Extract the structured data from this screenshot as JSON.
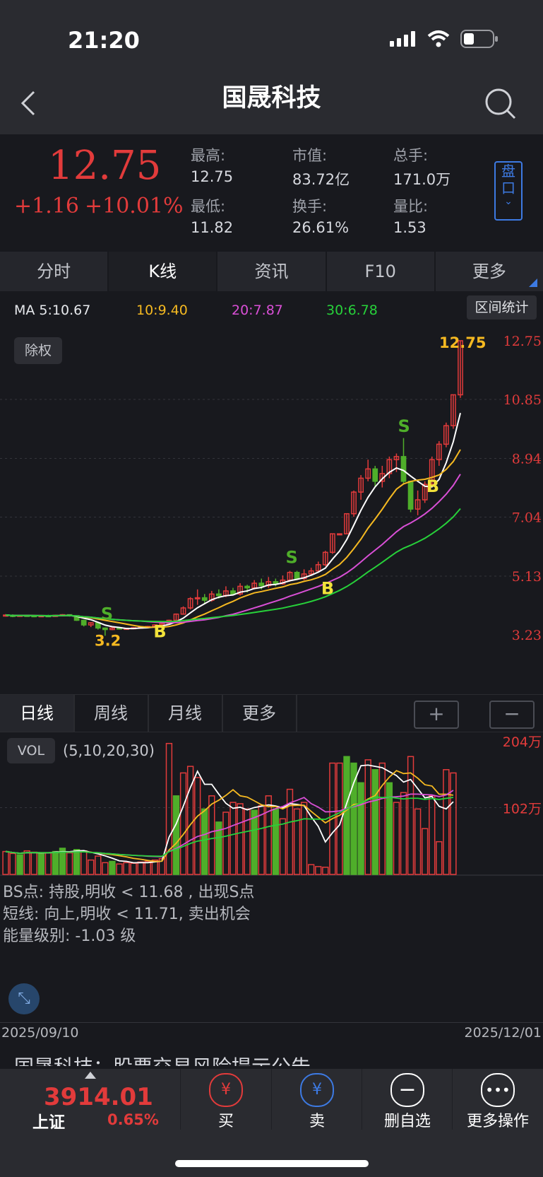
{
  "status_bar": {
    "time": "21:20"
  },
  "nav": {
    "title": "国晟科技"
  },
  "quote": {
    "price": "12.75",
    "change": "+1.16",
    "change_pct": "+10.01%",
    "stats": [
      {
        "label": "最高:",
        "value": "12.75"
      },
      {
        "label": "市值:",
        "value": "83.72亿"
      },
      {
        "label": "总手:",
        "value": "171.0万"
      },
      {
        "label": "最低:",
        "value": "11.82"
      },
      {
        "label": "换手:",
        "value": "26.61%"
      },
      {
        "label": "量比:",
        "value": "1.53"
      }
    ],
    "panel_button": "盘口"
  },
  "tabs": [
    "分时",
    "K线",
    "资讯",
    "F10",
    "更多"
  ],
  "ma": {
    "ma5": "MA 5:10.67",
    "ma10": "10:9.40",
    "ma20": "20:7.87",
    "ma30": "30:6.78"
  },
  "range_button": "区间统计",
  "chuquan": "除权",
  "colors": {
    "up": "#e23b3b",
    "down": "#4fae2a",
    "ma5": "#ffffff",
    "ma10": "#f5b921",
    "ma20": "#d94fd6",
    "ma30": "#27d13a",
    "accent": "#3d7ae3"
  },
  "price_axis": [
    "12.75",
    "10.85",
    "8.94",
    "7.04",
    "5.13",
    "3.23"
  ],
  "markers": {
    "high": "12.75",
    "low": "3.2",
    "s": "S",
    "b": "B"
  },
  "period_tabs": [
    "日线",
    "周线",
    "月线",
    "更多"
  ],
  "zoom": {
    "in": "+",
    "out": "−"
  },
  "volume": {
    "badge": "VOL",
    "params": "(5,10,20,30)",
    "axis": [
      "204万",
      "102万"
    ]
  },
  "notes": [
    "BS点: 持股,明收 < 11.68 , 出现S点",
    " 短线: 向上,明收 < 11.71, 卖出机会",
    " 能量级别: -1.03 级"
  ],
  "dates": {
    "start": "2025/09/10",
    "end": "2025/12/01"
  },
  "news": "国晟科技：股票交易风险提示公告",
  "bottom": {
    "index_value": "3914.01",
    "index_name": "上证",
    "index_pct": "0.65%",
    "buy": "买",
    "sell": "卖",
    "remove": "删自选",
    "more_ops": "更多操作"
  },
  "chart_data": {
    "type": "candlestick",
    "x_range": [
      "2025/09/10",
      "2025/12/01"
    ],
    "price_ylim": [
      3.23,
      12.75
    ],
    "candles": [
      [
        3.85,
        3.87,
        3.82,
        3.9
      ],
      [
        3.86,
        3.84,
        3.8,
        3.89
      ],
      [
        3.84,
        3.86,
        3.82,
        3.88
      ],
      [
        3.86,
        3.85,
        3.83,
        3.88
      ],
      [
        3.85,
        3.83,
        3.8,
        3.87
      ],
      [
        3.83,
        3.85,
        3.81,
        3.87
      ],
      [
        3.85,
        3.84,
        3.82,
        3.88
      ],
      [
        3.84,
        3.86,
        3.83,
        3.88
      ],
      [
        3.86,
        3.88,
        3.85,
        3.9
      ],
      [
        3.88,
        3.85,
        3.82,
        3.89
      ],
      [
        3.85,
        3.7,
        3.68,
        3.86
      ],
      [
        3.7,
        3.55,
        3.5,
        3.71
      ],
      [
        3.55,
        3.62,
        3.48,
        3.64
      ],
      [
        3.62,
        3.45,
        3.4,
        3.63
      ],
      [
        3.45,
        3.4,
        3.2,
        3.47
      ],
      [
        3.4,
        3.45,
        3.38,
        3.48
      ],
      [
        3.45,
        3.42,
        3.4,
        3.47
      ],
      [
        3.42,
        3.44,
        3.4,
        3.46
      ],
      [
        3.44,
        3.46,
        3.42,
        3.48
      ],
      [
        3.46,
        3.48,
        3.44,
        3.5
      ],
      [
        3.48,
        3.5,
        3.46,
        3.52
      ],
      [
        3.5,
        3.55,
        3.48,
        3.57
      ],
      [
        3.55,
        3.6,
        3.53,
        3.62
      ],
      [
        3.6,
        3.7,
        3.58,
        3.72
      ],
      [
        3.7,
        3.9,
        3.68,
        3.92
      ],
      [
        3.9,
        4.1,
        3.88,
        4.15
      ],
      [
        4.1,
        4.4,
        4.05,
        4.45
      ],
      [
        4.4,
        4.43,
        4.2,
        4.7
      ],
      [
        4.43,
        4.35,
        4.25,
        4.55
      ],
      [
        4.35,
        4.55,
        4.3,
        4.65
      ],
      [
        4.55,
        4.5,
        4.4,
        4.7
      ],
      [
        4.5,
        4.65,
        4.45,
        4.8
      ],
      [
        4.65,
        4.55,
        4.5,
        4.75
      ],
      [
        4.55,
        4.8,
        4.5,
        4.9
      ],
      [
        4.8,
        4.75,
        4.6,
        4.85
      ],
      [
        4.75,
        4.9,
        4.7,
        5.0
      ],
      [
        4.9,
        4.82,
        4.7,
        5.05
      ],
      [
        4.82,
        4.95,
        4.75,
        5.1
      ],
      [
        4.95,
        4.88,
        4.8,
        5.05
      ],
      [
        4.88,
        5.0,
        4.85,
        5.15
      ],
      [
        5.0,
        5.25,
        4.95,
        5.3
      ],
      [
        5.25,
        5.05,
        5.0,
        5.3
      ],
      [
        5.05,
        5.2,
        5.0,
        5.35
      ],
      [
        5.2,
        5.3,
        5.15,
        5.4
      ],
      [
        5.3,
        5.5,
        5.25,
        5.6
      ],
      [
        5.5,
        5.9,
        5.45,
        5.95
      ],
      [
        5.9,
        6.5,
        5.85,
        6.5
      ],
      [
        6.5,
        6.5,
        6.5,
        6.5
      ],
      [
        6.5,
        7.15,
        6.5,
        7.15
      ],
      [
        7.15,
        7.85,
        7.05,
        7.9
      ],
      [
        7.85,
        8.3,
        7.6,
        8.4
      ],
      [
        8.3,
        8.6,
        8.2,
        8.9
      ],
      [
        8.6,
        8.2,
        8.0,
        8.7
      ],
      [
        8.2,
        8.45,
        8.0,
        8.7
      ],
      [
        8.45,
        8.9,
        8.3,
        9.0
      ],
      [
        8.9,
        9.0,
        8.5,
        9.1
      ],
      [
        9.0,
        8.2,
        8.1,
        9.6
      ],
      [
        8.2,
        7.3,
        7.2,
        7.5
      ],
      [
        7.3,
        7.6,
        7.1,
        7.9
      ],
      [
        7.6,
        8.1,
        7.5,
        8.2
      ],
      [
        8.1,
        8.9,
        8.0,
        9.0
      ],
      [
        8.9,
        9.4,
        8.7,
        9.5
      ],
      [
        9.4,
        10.0,
        9.3,
        10.1
      ],
      [
        10.0,
        11.0,
        9.9,
        11.0
      ],
      [
        11.0,
        12.75,
        10.9,
        12.75
      ]
    ],
    "volume_ylim": [
      0,
      204
    ],
    "volume_unit": "万",
    "volume": [
      [
        35,
        1
      ],
      [
        32,
        1
      ],
      [
        30,
        0
      ],
      [
        36,
        1
      ],
      [
        34,
        1
      ],
      [
        32,
        0
      ],
      [
        33,
        1
      ],
      [
        35,
        0
      ],
      [
        40,
        0
      ],
      [
        33,
        1
      ],
      [
        38,
        0
      ],
      [
        36,
        1
      ],
      [
        22,
        1
      ],
      [
        28,
        1
      ],
      [
        18,
        1
      ],
      [
        20,
        0
      ],
      [
        16,
        1
      ],
      [
        18,
        1
      ],
      [
        17,
        1
      ],
      [
        19,
        1
      ],
      [
        20,
        1
      ],
      [
        22,
        1
      ],
      [
        24,
        1
      ],
      [
        200,
        1
      ],
      [
        120,
        0
      ],
      [
        155,
        1
      ],
      [
        165,
        1
      ],
      [
        148,
        1
      ],
      [
        100,
        0
      ],
      [
        120,
        1
      ],
      [
        80,
        0
      ],
      [
        95,
        1
      ],
      [
        110,
        1
      ],
      [
        108,
        1
      ],
      [
        100,
        1
      ],
      [
        98,
        0
      ],
      [
        105,
        1
      ],
      [
        120,
        1
      ],
      [
        100,
        0
      ],
      [
        85,
        1
      ],
      [
        130,
        1
      ],
      [
        100,
        1
      ],
      [
        110,
        1
      ],
      [
        15,
        1
      ],
      [
        12,
        1
      ],
      [
        11,
        1
      ],
      [
        170,
        1
      ],
      [
        170,
        1
      ],
      [
        180,
        0
      ],
      [
        170,
        0
      ],
      [
        140,
        0
      ],
      [
        175,
        1
      ],
      [
        160,
        0
      ],
      [
        170,
        1
      ],
      [
        140,
        0
      ],
      [
        110,
        1
      ],
      [
        125,
        1
      ],
      [
        180,
        1
      ],
      [
        100,
        1
      ],
      [
        70,
        1
      ],
      [
        120,
        1
      ],
      [
        50,
        1
      ],
      [
        160,
        1
      ],
      [
        155,
        1
      ]
    ]
  }
}
